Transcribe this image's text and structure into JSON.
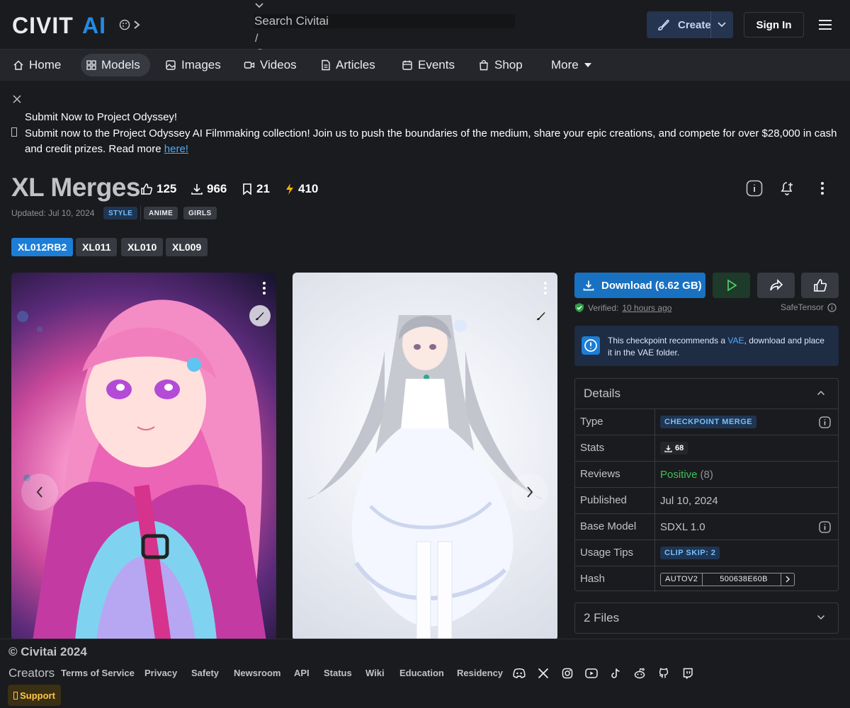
{
  "header": {
    "logo_text": "CIVITAI",
    "search_placeholder": "Search Civitai",
    "search_hotkey": "/",
    "create_label": "Create",
    "signin_label": "Sign In"
  },
  "nav": {
    "items": [
      {
        "label": "Home",
        "icon": "home-icon"
      },
      {
        "label": "Models",
        "icon": "models-grid-icon",
        "active": true
      },
      {
        "label": "Images",
        "icon": "image-icon"
      },
      {
        "label": "Videos",
        "icon": "video-icon"
      },
      {
        "label": "Articles",
        "icon": "article-icon"
      },
      {
        "label": "Events",
        "icon": "calendar-icon"
      },
      {
        "label": "Shop",
        "icon": "shop-bag-icon"
      },
      {
        "label": "More",
        "icon": "caret-down-icon"
      }
    ]
  },
  "banner": {
    "title": "Submit Now to Project Odyssey!",
    "body": "Submit now to the Project Odyssey AI Filmmaking collection! Join us to push the boundaries of the medium, share your epic creations, and compete for over $28,000 in cash and credit prizes. Read more ",
    "link": "here!"
  },
  "model": {
    "title": "XL Merges",
    "likes": "125",
    "downloads": "966",
    "bookmarks": "21",
    "buzz": "410",
    "updated": "Updated: Jul 10, 2024",
    "tags": [
      "STYLE",
      "ANIME",
      "GIRLS"
    ],
    "versions": [
      "XL012RB2",
      "XL011",
      "XL010",
      "XL009"
    ]
  },
  "sidebar": {
    "download_label": "Download (6.62 GB)",
    "verified_prefix": "Verified:",
    "verified_time": "10 hours ago",
    "file_format": "SafeTensor",
    "vae_text_1": "This checkpoint recommends a ",
    "vae_link": "VAE",
    "vae_text_2": ", download and place it in the VAE folder."
  },
  "details": {
    "title": "Details",
    "type_label": "Type",
    "type_value": "CHECKPOINT MERGE",
    "stats_label": "Stats",
    "stats_downloads": "68",
    "reviews_label": "Reviews",
    "reviews_sentiment": "Positive",
    "reviews_count": "(8)",
    "published_label": "Published",
    "published_value": "Jul 10, 2024",
    "base_model_label": "Base Model",
    "base_model_value": "SDXL 1.0",
    "usage_tips_label": "Usage Tips",
    "usage_tips_value": "CLIP SKIP: 2",
    "hash_label": "Hash",
    "hash_type": "AUTOV2",
    "hash_value": "500638E60B"
  },
  "files": {
    "label": "2 Files"
  },
  "footer": {
    "copyright": "© Civitai 2024",
    "creators": "Creators",
    "links": [
      "Terms of Service",
      "Privacy",
      "Safety",
      "Newsroom",
      "API",
      "Status",
      "Wiki",
      "Education",
      "Residency"
    ],
    "social_icons": [
      "discord-icon",
      "x-icon",
      "instagram-icon",
      "youtube-icon",
      "tiktok-icon",
      "reddit-icon",
      "github-icon",
      "twitch-icon"
    ],
    "support_label": "Support"
  },
  "colors": {
    "accent": "#1c7ed6",
    "background": "#1a1b1e",
    "positive": "#40c057",
    "buzz": "#fab005"
  }
}
